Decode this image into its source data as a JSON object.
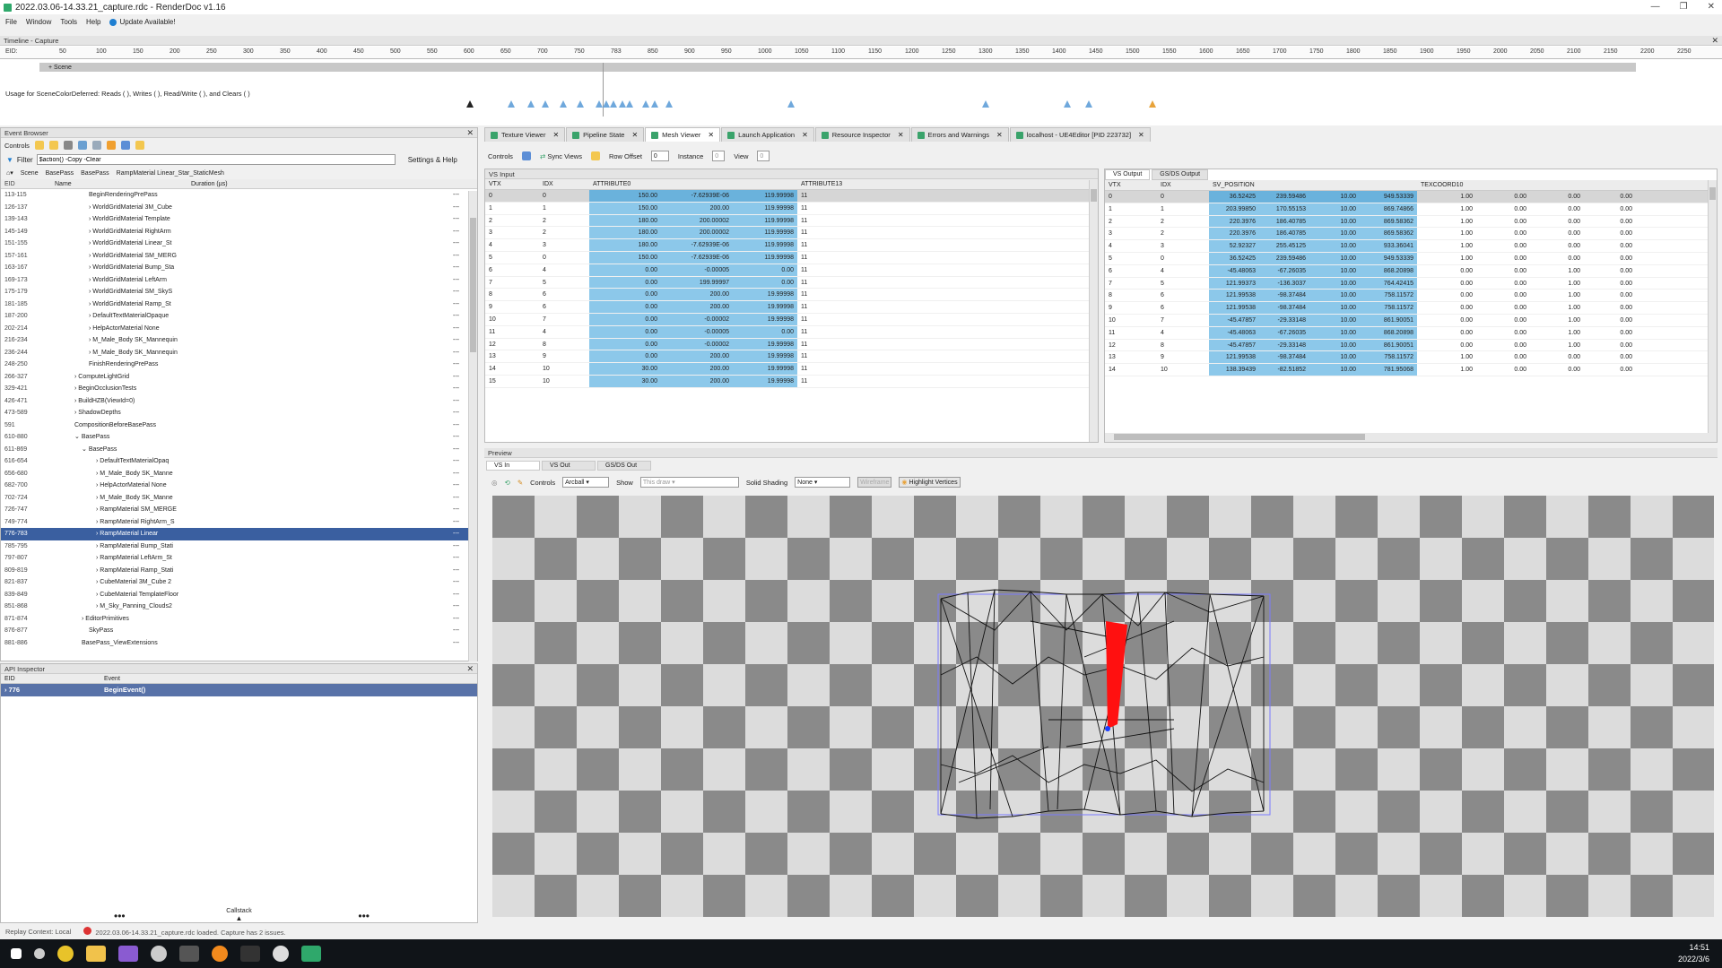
{
  "window": {
    "title": "2022.03.06-14.33.21_capture.rdc - RenderDoc v1.16",
    "controls": [
      "—",
      "❐",
      "✕"
    ]
  },
  "menu": {
    "file": "File",
    "window": "Window",
    "tools": "Tools",
    "help": "Help",
    "update": "Update Available!"
  },
  "timeline": {
    "header": "Timeline - Capture",
    "eid_label": "EID:",
    "ticks": [
      "50",
      "100",
      "150",
      "200",
      "250",
      "300",
      "350",
      "400",
      "450",
      "500",
      "550",
      "600",
      "650",
      "700",
      "750",
      "783",
      "850",
      "900",
      "950",
      "1000",
      "1050",
      "1100",
      "1150",
      "1200",
      "1250",
      "1300",
      "1350",
      "1400",
      "1450",
      "1500",
      "1550",
      "1600",
      "1650",
      "1700",
      "1750",
      "1800",
      "1850",
      "1900",
      "1950",
      "2000",
      "2050",
      "2100",
      "2150",
      "2200",
      "2250"
    ],
    "scene_label": "+ Scene",
    "usage_text": "Usage for SceneColorDeferred: Reads ( ), Writes ( ), Read/Write ( ), and Clears ( )"
  },
  "event_browser": {
    "header": "Event Browser",
    "controls_label": "Controls",
    "filter_label": "Filter",
    "filter_value": "$action() -Copy -Clear",
    "settings_label": "Settings & Help",
    "crumbs": [
      "Scene",
      "BasePass",
      "BasePass",
      "RampMaterial Linear_Star_StaticMesh"
    ],
    "col_eid": "EID",
    "col_name": "Name",
    "col_duration": "Duration (µs)",
    "rows": [
      {
        "eid": "113-115",
        "name": "BeginRenderingPrePass",
        "d": "---"
      },
      {
        "eid": "126-137",
        "name": "WorldGridMaterial 3M_Cube",
        "d": "---"
      },
      {
        "eid": "139-143",
        "name": "WorldGridMaterial Template",
        "d": "---"
      },
      {
        "eid": "145-149",
        "name": "WorldGridMaterial RightArm",
        "d": "---"
      },
      {
        "eid": "151-155",
        "name": "WorldGridMaterial Linear_St",
        "d": "---"
      },
      {
        "eid": "157-161",
        "name": "WorldGridMaterial SM_MERG",
        "d": "---"
      },
      {
        "eid": "163-167",
        "name": "WorldGridMaterial Bump_Sta",
        "d": "---"
      },
      {
        "eid": "169-173",
        "name": "WorldGridMaterial LeftArm",
        "d": "---"
      },
      {
        "eid": "175-179",
        "name": "WorldGridMaterial SM_SkyS",
        "d": "---"
      },
      {
        "eid": "181-185",
        "name": "WorldGridMaterial Ramp_St",
        "d": "---"
      },
      {
        "eid": "187-200",
        "name": "DefaultTextMaterialOpaque",
        "d": "---"
      },
      {
        "eid": "202-214",
        "name": "HelpActorMaterial None",
        "d": "---"
      },
      {
        "eid": "216-234",
        "name": "M_Male_Body SK_Mannequin",
        "d": "---"
      },
      {
        "eid": "236-244",
        "name": "M_Male_Body SK_Mannequin",
        "d": "---"
      },
      {
        "eid": "248-250",
        "name": "FinishRenderingPrePass",
        "d": "---"
      },
      {
        "eid": "266-327",
        "name": "ComputeLightGrid",
        "d": "---"
      },
      {
        "eid": "329-421",
        "name": "BeginOcclusionTests",
        "d": "---"
      },
      {
        "eid": "426-471",
        "name": "BuildHZB(ViewId=0)",
        "d": "---"
      },
      {
        "eid": "473-589",
        "name": "ShadowDepths",
        "d": "---"
      },
      {
        "eid": "591",
        "name": "CompositionBeforeBasePass",
        "d": "---"
      },
      {
        "eid": "610-880",
        "name": "BasePass",
        "d": "---"
      },
      {
        "eid": "611-869",
        "name": "BasePass",
        "d": "---"
      },
      {
        "eid": "616-654",
        "name": "DefaultTextMaterialOpaq",
        "d": "---"
      },
      {
        "eid": "656-680",
        "name": "M_Male_Body SK_Manne",
        "d": "---"
      },
      {
        "eid": "682-700",
        "name": "HelpActorMaterial None",
        "d": "---"
      },
      {
        "eid": "702-724",
        "name": "M_Male_Body SK_Manne",
        "d": "---"
      },
      {
        "eid": "726-747",
        "name": "RampMaterial SM_MERGE",
        "d": "---"
      },
      {
        "eid": "749-774",
        "name": "RampMaterial RightArm_S",
        "d": "---"
      },
      {
        "eid": "776-783",
        "name": "RampMaterial Linear",
        "d": "---"
      },
      {
        "eid": "785-795",
        "name": "RampMaterial Bump_Stati",
        "d": "---"
      },
      {
        "eid": "797-807",
        "name": "RampMaterial LeftArm_St",
        "d": "---"
      },
      {
        "eid": "809-819",
        "name": "RampMaterial Ramp_Stati",
        "d": "---"
      },
      {
        "eid": "821-837",
        "name": "CubeMaterial 3M_Cube 2",
        "d": "---"
      },
      {
        "eid": "839-849",
        "name": "CubeMaterial TemplateFloor",
        "d": "---"
      },
      {
        "eid": "851-868",
        "name": "M_Sky_Panning_Clouds2",
        "d": "---"
      },
      {
        "eid": "871-874",
        "name": "EditorPrimitives",
        "d": "---"
      },
      {
        "eid": "876-877",
        "name": "SkyPass",
        "d": "---"
      },
      {
        "eid": "881-886",
        "name": "BasePass_ViewExtensions",
        "d": "---"
      }
    ]
  },
  "api_inspector": {
    "header": "API Inspector",
    "col_eid": "EID",
    "col_event": "Event",
    "row_eid": "776",
    "row_event": "BeginEvent()",
    "callstack": "Callstack"
  },
  "tabs": [
    {
      "label": "Texture Viewer"
    },
    {
      "label": "Pipeline State"
    },
    {
      "label": "Mesh Viewer"
    },
    {
      "label": "Launch Application"
    },
    {
      "label": "Resource Inspector"
    },
    {
      "label": "Errors and Warnings"
    },
    {
      "label": "localhost - UE4Editor [PID 223732]"
    }
  ],
  "mesh_toolbar": {
    "controls": "Controls",
    "sync": "Sync Views",
    "row_offset": "Row Offset",
    "row_offset_val": "0",
    "instance": "Instance",
    "instance_val": "0",
    "view": "View",
    "view_val": "0"
  },
  "vs_input": {
    "header": "VS Input",
    "cols": [
      "VTX",
      "IDX",
      "ATTRIBUTE0",
      "",
      "",
      "ATTRIBUTE13"
    ],
    "rows": [
      [
        "0",
        "0",
        "150.00",
        "-7.62939E-06",
        "119.99998",
        "11"
      ],
      [
        "1",
        "1",
        "150.00",
        "200.00",
        "119.99998",
        "11"
      ],
      [
        "2",
        "2",
        "180.00",
        "200.00002",
        "119.99998",
        "11"
      ],
      [
        "3",
        "2",
        "180.00",
        "200.00002",
        "119.99998",
        "11"
      ],
      [
        "4",
        "3",
        "180.00",
        "-7.62939E-06",
        "119.99998",
        "11"
      ],
      [
        "5",
        "0",
        "150.00",
        "-7.62939E-06",
        "119.99998",
        "11"
      ],
      [
        "6",
        "4",
        "0.00",
        "-0.00005",
        "0.00",
        "11"
      ],
      [
        "7",
        "5",
        "0.00",
        "199.99997",
        "0.00",
        "11"
      ],
      [
        "8",
        "6",
        "0.00",
        "200.00",
        "19.99998",
        "11"
      ],
      [
        "9",
        "6",
        "0.00",
        "200.00",
        "19.99998",
        "11"
      ],
      [
        "10",
        "7",
        "0.00",
        "-0.00002",
        "19.99998",
        "11"
      ],
      [
        "11",
        "4",
        "0.00",
        "-0.00005",
        "0.00",
        "11"
      ],
      [
        "12",
        "8",
        "0.00",
        "-0.00002",
        "19.99998",
        "11"
      ],
      [
        "13",
        "9",
        "0.00",
        "200.00",
        "19.99998",
        "11"
      ],
      [
        "14",
        "10",
        "30.00",
        "200.00",
        "19.99998",
        "11"
      ],
      [
        "15",
        "10",
        "30.00",
        "200.00",
        "19.99998",
        "11"
      ]
    ]
  },
  "vs_output": {
    "tab1": "VS Output",
    "tab2": "GS/DS Output",
    "cols": [
      "VTX",
      "IDX",
      "SV_POSITION",
      "",
      "",
      "",
      "TEXCOORD10",
      "",
      "",
      ""
    ],
    "rows": [
      [
        "0",
        "0",
        "36.52425",
        "239.59486",
        "10.00",
        "949.53339",
        "1.00",
        "0.00",
        "0.00",
        "0.00"
      ],
      [
        "1",
        "1",
        "203.99850",
        "170.55153",
        "10.00",
        "869.74866",
        "1.00",
        "0.00",
        "0.00",
        "0.00"
      ],
      [
        "2",
        "2",
        "220.3976",
        "186.40785",
        "10.00",
        "869.58362",
        "1.00",
        "0.00",
        "0.00",
        "0.00"
      ],
      [
        "3",
        "2",
        "220.3976",
        "186.40785",
        "10.00",
        "869.58362",
        "1.00",
        "0.00",
        "0.00",
        "0.00"
      ],
      [
        "4",
        "3",
        "52.92327",
        "255.45125",
        "10.00",
        "933.36041",
        "1.00",
        "0.00",
        "0.00",
        "0.00"
      ],
      [
        "5",
        "0",
        "36.52425",
        "239.59486",
        "10.00",
        "949.53339",
        "1.00",
        "0.00",
        "0.00",
        "0.00"
      ],
      [
        "6",
        "4",
        "-45.48063",
        "-67.26035",
        "10.00",
        "868.20898",
        "0.00",
        "0.00",
        "1.00",
        "0.00"
      ],
      [
        "7",
        "5",
        "121.99373",
        "-136.3037",
        "10.00",
        "764.42415",
        "0.00",
        "0.00",
        "1.00",
        "0.00"
      ],
      [
        "8",
        "6",
        "121.99538",
        "-98.37484",
        "10.00",
        "758.11572",
        "0.00",
        "0.00",
        "1.00",
        "0.00"
      ],
      [
        "9",
        "6",
        "121.99538",
        "-98.37484",
        "10.00",
        "758.11572",
        "0.00",
        "0.00",
        "1.00",
        "0.00"
      ],
      [
        "10",
        "7",
        "-45.47857",
        "-29.33148",
        "10.00",
        "861.90051",
        "0.00",
        "0.00",
        "1.00",
        "0.00"
      ],
      [
        "11",
        "4",
        "-45.48063",
        "-67.26035",
        "10.00",
        "868.20898",
        "0.00",
        "0.00",
        "1.00",
        "0.00"
      ],
      [
        "12",
        "8",
        "-45.47857",
        "-29.33148",
        "10.00",
        "861.90051",
        "0.00",
        "0.00",
        "1.00",
        "0.00"
      ],
      [
        "13",
        "9",
        "121.99538",
        "-98.37484",
        "10.00",
        "758.11572",
        "1.00",
        "0.00",
        "0.00",
        "0.00"
      ],
      [
        "14",
        "10",
        "138.39439",
        "-82.51852",
        "10.00",
        "781.95068",
        "1.00",
        "0.00",
        "0.00",
        "0.00"
      ]
    ]
  },
  "preview": {
    "header": "Preview",
    "tab_vsin": "VS In",
    "tab_vsout": "VS Out",
    "tab_gsds": "GS/DS Out",
    "controls": "Controls",
    "controls_val": "Arcball",
    "show": "Show",
    "show_val": "This draw",
    "solid": "Solid Shading",
    "solid_val": "None",
    "wireframe": "Wireframe",
    "highlight": "Highlight Vertices"
  },
  "status": {
    "replay": "Replay Context: Local",
    "message": "2022.03.06-14.33.21_capture.rdc loaded. Capture has 2 issues."
  },
  "taskbar": {
    "time": "14:51",
    "date": "2022/3/6"
  }
}
